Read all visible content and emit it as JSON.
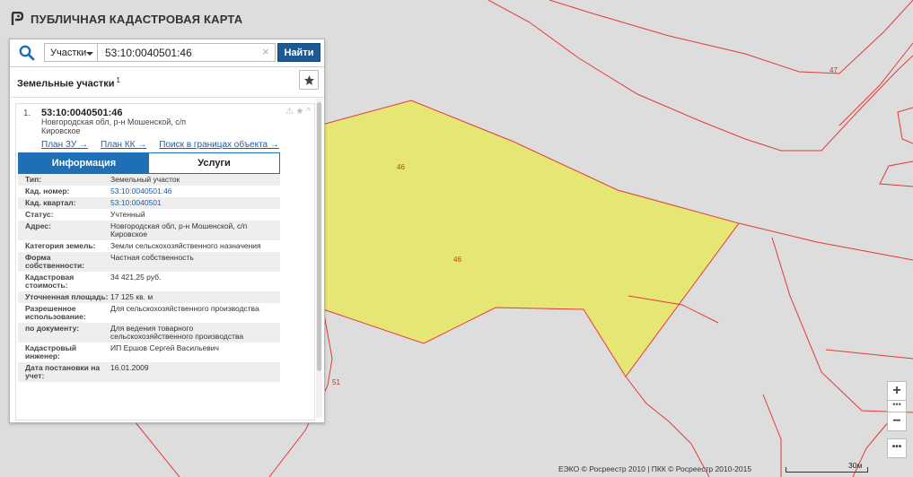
{
  "header": {
    "title": "ПУБЛИЧНАЯ КАДАСТРОВАЯ КАРТА"
  },
  "search": {
    "type": "Участки",
    "value": "53:10:0040501:46",
    "clear": "×",
    "button": "Найти"
  },
  "results": {
    "title": "Земельные участки",
    "count": "1",
    "item": {
      "index": "1.",
      "number": "53:10:0040501:46",
      "address": "Новгородская обл, р-н Мошенской, с/п Кировское",
      "icons": "⚠ ★ ^",
      "links": [
        "План ЗУ →",
        "План КК →",
        "Поиск в границах объекта →"
      ],
      "tabs": [
        "Информация",
        "Услуги"
      ],
      "attributes": [
        {
          "k": "Тип:",
          "v": "Земельный участок"
        },
        {
          "k": "Кад. номер:",
          "v": "53:10:0040501:46"
        },
        {
          "k": "Кад. квартал:",
          "v": "53:10:0040501"
        },
        {
          "k": "Статус:",
          "v": "Учтенный"
        },
        {
          "k": "Адрес:",
          "v": "Новгородская обл, р-н Мошенской, с/п Кировское"
        },
        {
          "k": "Категория земель:",
          "v": "Земли сельскохозяйственного назначения"
        },
        {
          "k": "Форма собственности:",
          "v": "Частная собственность"
        },
        {
          "k": "Кадастровая стоимость:",
          "v": "34 421,25 руб."
        },
        {
          "k": "Уточненная площадь:",
          "v": "17 125 кв. м"
        },
        {
          "k": "Разрешенное использование:",
          "v": "Для сельскохозяйственного производства"
        },
        {
          "k": "по документу:",
          "v": "Для ведения товарного сельскохозяйственного производства"
        },
        {
          "k": "Кадастровый инженер:",
          "v": "ИП Ершов Сергей Васильевич"
        },
        {
          "k": "Дата постановки на учет:",
          "v": "16.01.2009"
        }
      ]
    }
  },
  "map": {
    "labels": {
      "parcel_small": "46",
      "parcel_main": "46",
      "north": "47",
      "west": "51"
    },
    "colors": {
      "parcel_fill": "#e6e674",
      "boundary": "#e23b3b",
      "background": "#dddddd"
    }
  },
  "controls": {
    "zoom_in": "+",
    "zoom_dots": "•••",
    "zoom_out": "−",
    "more": "•••"
  },
  "footer": {
    "attribution": "ЕЭКО © Росреестр 2010 | ПКК © Росреестр 2010-2015",
    "scale": "30м"
  }
}
